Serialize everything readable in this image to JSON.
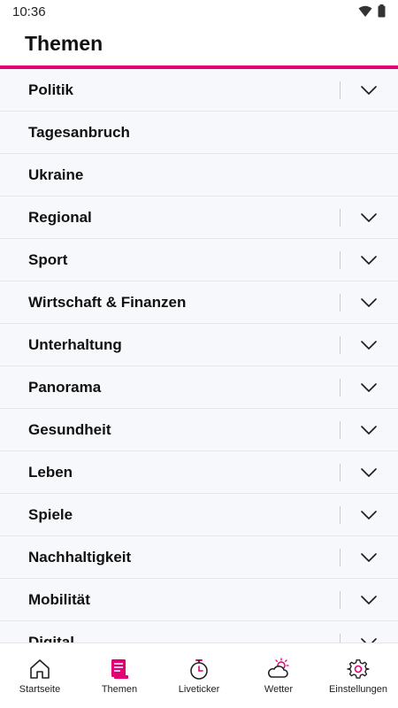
{
  "status_bar": {
    "time": "10:36"
  },
  "header": {
    "title": "Themen"
  },
  "colors": {
    "accent": "#e20074",
    "list_background": "#f7f8fb",
    "text": "#111111"
  },
  "topics": [
    {
      "label": "Politik",
      "expandable": true
    },
    {
      "label": "Tagesanbruch",
      "expandable": false
    },
    {
      "label": "Ukraine",
      "expandable": false
    },
    {
      "label": "Regional",
      "expandable": true
    },
    {
      "label": "Sport",
      "expandable": true
    },
    {
      "label": "Wirtschaft & Finanzen",
      "expandable": true
    },
    {
      "label": "Unterhaltung",
      "expandable": true
    },
    {
      "label": "Panorama",
      "expandable": true
    },
    {
      "label": "Gesundheit",
      "expandable": true
    },
    {
      "label": "Leben",
      "expandable": true
    },
    {
      "label": "Spiele",
      "expandable": true
    },
    {
      "label": "Nachhaltigkeit",
      "expandable": true
    },
    {
      "label": "Mobilität",
      "expandable": true
    },
    {
      "label": "Digital",
      "expandable": true
    }
  ],
  "bottom_nav": [
    {
      "label": "Startseite",
      "icon": "home-icon",
      "active": false
    },
    {
      "label": "Themen",
      "icon": "topics-icon",
      "active": true
    },
    {
      "label": "Liveticker",
      "icon": "stopwatch-icon",
      "active": false
    },
    {
      "label": "Wetter",
      "icon": "weather-icon",
      "active": false
    },
    {
      "label": "Einstellungen",
      "icon": "gear-icon",
      "active": false
    }
  ]
}
